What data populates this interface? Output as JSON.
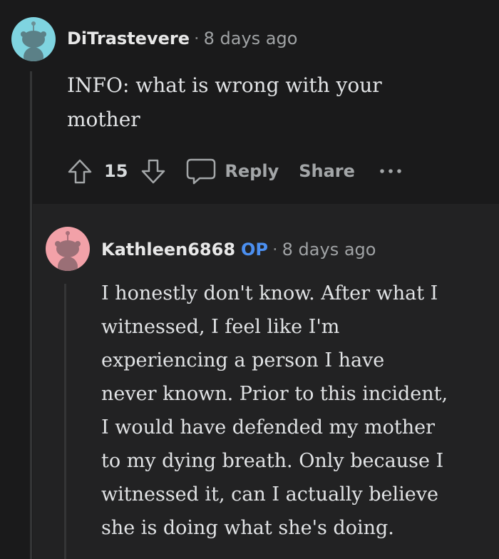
{
  "colors": {
    "background": "#1a1a1b",
    "reply_background": "#222223",
    "op_badge": "#4b8ff0",
    "avatar_1": "#7fd4e0",
    "avatar_2": "#f2a1a8"
  },
  "comments": [
    {
      "username": "DiTrastevere",
      "separator": "·",
      "time": "8 days ago",
      "body_lines": [
        "INFO: what is wrong with your",
        "mother"
      ],
      "vote_count": "15",
      "reply_label": "Reply",
      "share_label": "Share",
      "icons": [
        "upvote-icon",
        "downvote-icon",
        "comment-icon",
        "more-icon"
      ]
    },
    {
      "username": "Kathleen6868",
      "badge": "OP",
      "separator": "·",
      "time": "8 days ago",
      "body_lines": [
        "I honestly don't know. After what I",
        "witnessed, I feel like I'm",
        "experiencing a person I have",
        "never known. Prior to this incident,",
        "I would have defended my mother",
        "to my dying breath. Only because I",
        "witnessed it, can I actually believe",
        "she is doing what she's doing."
      ]
    }
  ]
}
